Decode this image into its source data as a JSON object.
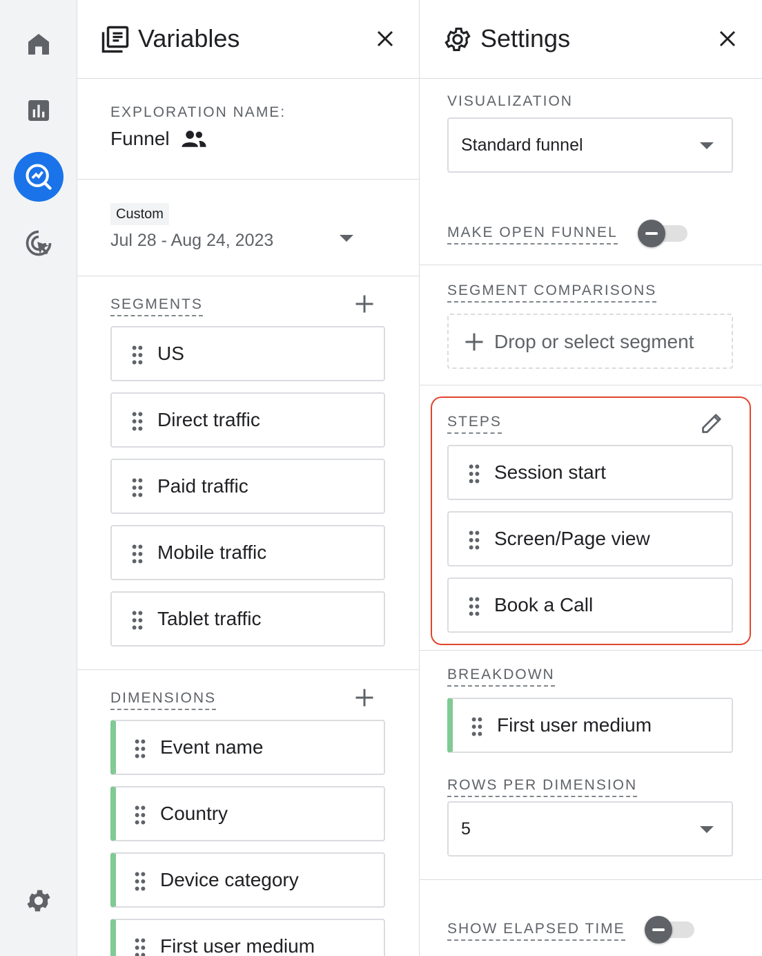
{
  "rail": {
    "icons": [
      "home-icon",
      "reports-icon",
      "explore-icon",
      "advertising-icon",
      "admin-gear-icon"
    ]
  },
  "variables": {
    "title": "Variables",
    "exploration_name_label": "EXPLORATION NAME:",
    "exploration_name": "Funnel",
    "date_badge": "Custom",
    "date_range": "Jul 28 - Aug 24, 2023",
    "segments_label": "SEGMENTS",
    "segments": [
      "US",
      "Direct traffic",
      "Paid traffic",
      "Mobile traffic",
      "Tablet traffic"
    ],
    "dimensions_label": "DIMENSIONS",
    "dimensions": [
      "Event name",
      "Country",
      "Device category",
      "First user medium"
    ]
  },
  "settings": {
    "title": "Settings",
    "visualization_label": "VISUALIZATION",
    "visualization_value": "Standard funnel",
    "open_funnel_label": "MAKE OPEN FUNNEL",
    "open_funnel_on": false,
    "segment_comparisons_label": "SEGMENT COMPARISONS",
    "drop_segment_text": "Drop or select segment",
    "steps_label": "STEPS",
    "steps": [
      "Session start",
      "Screen/Page view",
      "Book a Call"
    ],
    "breakdown_label": "BREAKDOWN",
    "breakdown_value": "First user medium",
    "rows_per_dimension_label": "ROWS PER DIMENSION",
    "rows_per_dimension_value": "5",
    "show_elapsed_time_label": "SHOW ELAPSED TIME",
    "show_elapsed_time_on": false
  },
  "colors": {
    "accent": "#1a73e8",
    "dimension_bar": "#81c995",
    "highlight_border": "#e0452c"
  }
}
